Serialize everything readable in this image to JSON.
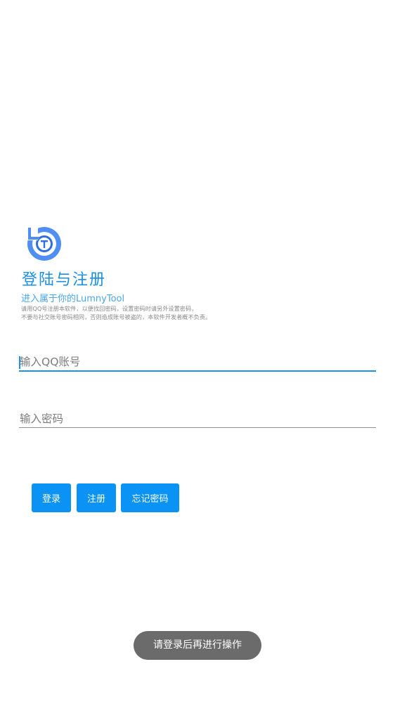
{
  "header": {
    "logo_icon": "lumnytool-logo-icon",
    "title": "登陆与注册",
    "subtitle": "进入属于你的LumnyTool",
    "notice_line1": "请用QQ号注册本软件，以便找回密码，设置密码时请另外设置密码，",
    "notice_line2": "不要与社交账号密码相同，否则造成账号被盗的，本软件开发者概不负责。"
  },
  "form": {
    "account_placeholder": "输入QQ账号",
    "account_value": "",
    "password_placeholder": "输入密码",
    "password_value": ""
  },
  "actions": {
    "login_label": "登录",
    "register_label": "注册",
    "forgot_label": "忘记密码"
  },
  "toast": {
    "message": "请登录后再进行操作"
  },
  "colors": {
    "accent": "#0a93f5",
    "title": "#1a8fe3",
    "toast_bg": "#6b6b6b"
  }
}
